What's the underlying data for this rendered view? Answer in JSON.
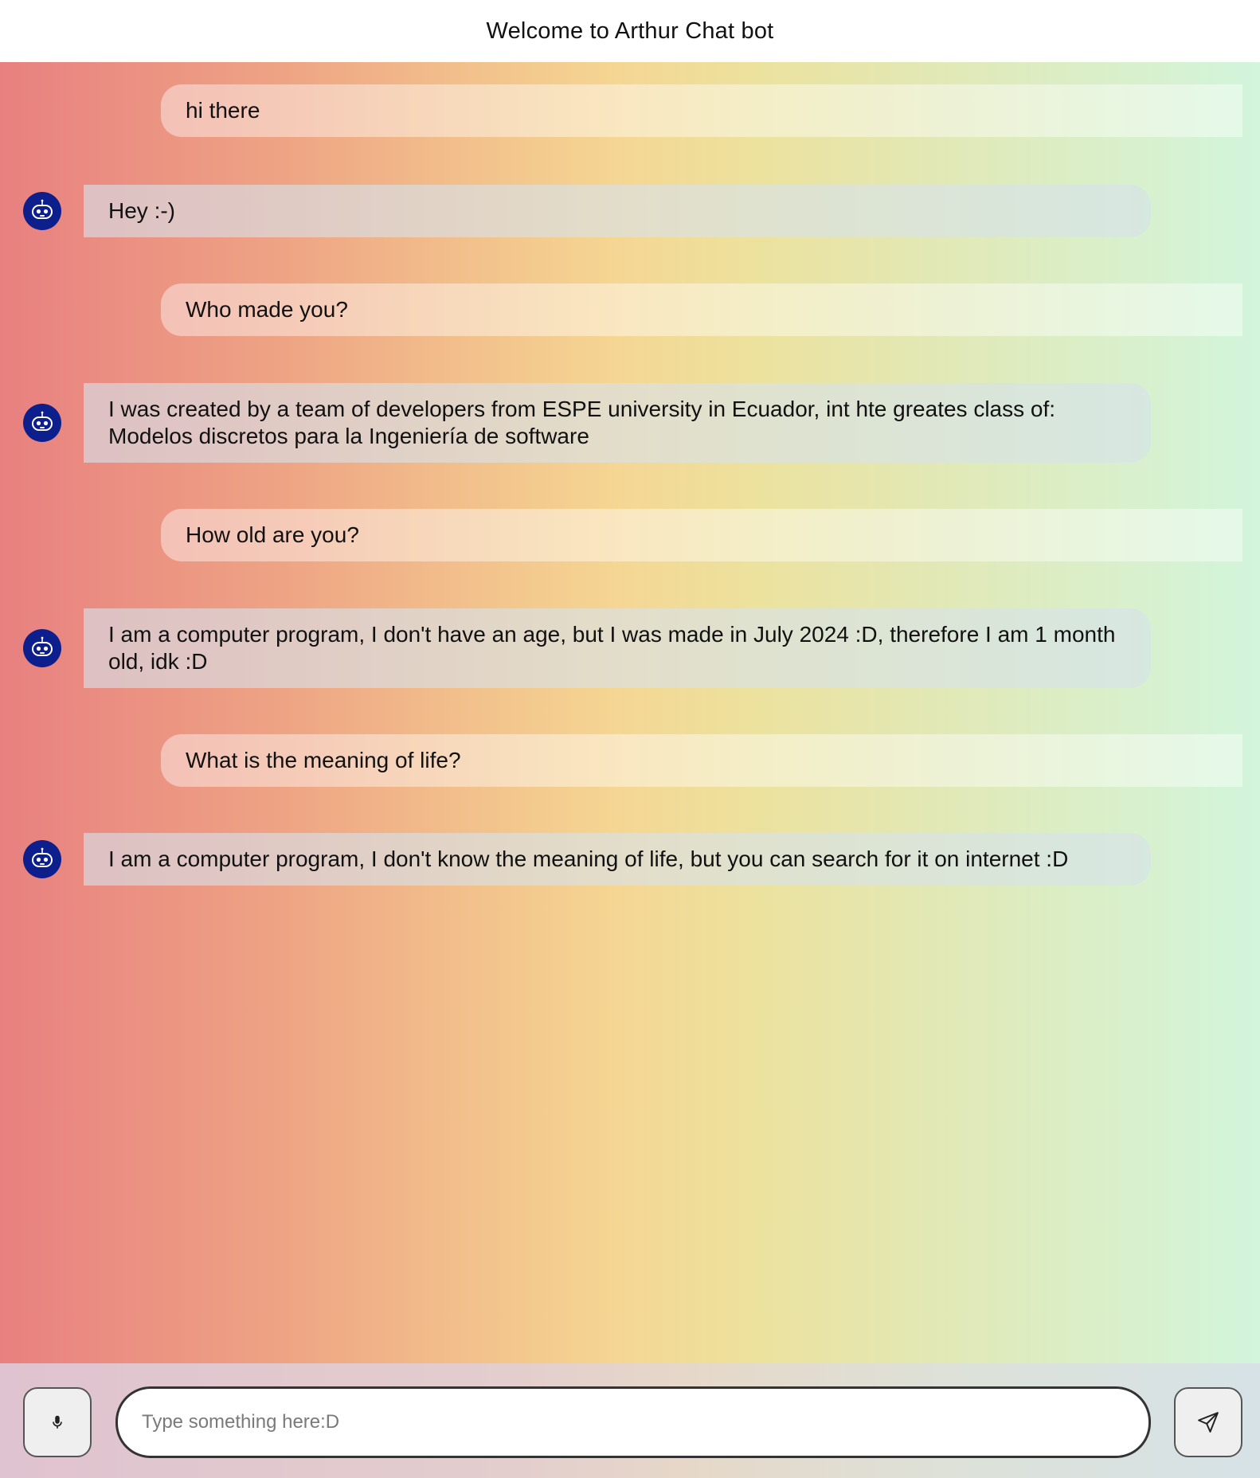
{
  "header": {
    "title": "Welcome to Arthur Chat bot"
  },
  "messages": [
    {
      "sender": "user",
      "text": "hi there"
    },
    {
      "sender": "bot",
      "text": "Hey :-)",
      "avatar_icon": "robot-icon"
    },
    {
      "sender": "user",
      "text": "Who made you?"
    },
    {
      "sender": "bot",
      "text": "I was created by a team of developers from ESPE university in Ecuador, int hte greates class of: Modelos discretos para la Ingeniería de software",
      "avatar_icon": "robot-icon"
    },
    {
      "sender": "user",
      "text": "How old are you?"
    },
    {
      "sender": "bot",
      "text": "I am a computer program, I don't have an age, but I was made in July 2024 :D, therefore I am 1 month old, idk :D",
      "avatar_icon": "robot-icon"
    },
    {
      "sender": "user",
      "text": "What is the meaning of life?"
    },
    {
      "sender": "bot",
      "text": "I am a computer program, I don't know the meaning of life, but you can search for it on internet :D",
      "avatar_icon": "robot-icon"
    }
  ],
  "composer": {
    "placeholder": "Type something here:D",
    "value": "",
    "mic_icon": "microphone-icon",
    "send_icon": "send-icon"
  },
  "colors": {
    "avatar_bg": "#0c1f8c",
    "gradient_left": "#e88080",
    "gradient_mid": "#f5d693",
    "gradient_right": "#d2f5dc"
  }
}
